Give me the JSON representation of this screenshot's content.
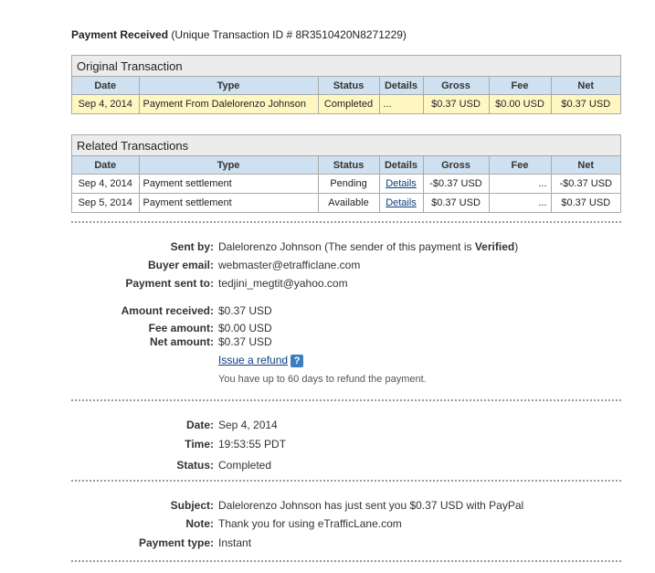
{
  "header": {
    "title": "Payment Received",
    "transaction_id": "(Unique Transaction ID # 8R3510420N8271229)"
  },
  "columns": [
    "Date",
    "Type",
    "Status",
    "Details",
    "Gross",
    "Fee",
    "Net"
  ],
  "original": {
    "title": "Original Transaction",
    "row": {
      "date": "Sep 4, 2014",
      "type": "Payment From Dalelorenzo Johnson",
      "status": "Completed",
      "details": "...",
      "gross": "$0.37 USD",
      "fee": "$0.00 USD",
      "net": "$0.37 USD"
    }
  },
  "related": {
    "title": "Related Transactions",
    "rows": [
      {
        "date": "Sep 4, 2014",
        "type": "Payment settlement",
        "status": "Pending",
        "details": "Details",
        "gross": "-$0.37 USD",
        "fee": "...",
        "net": "-$0.37 USD"
      },
      {
        "date": "Sep 5, 2014",
        "type": "Payment settlement",
        "status": "Available",
        "details": "Details",
        "gross": "$0.37 USD",
        "fee": "...",
        "net": "$0.37 USD"
      }
    ]
  },
  "sender": {
    "sent_by_label": "Sent by:",
    "sent_by_name": "Dalelorenzo Johnson",
    "sent_by_note_pre": "(The sender of this payment is ",
    "sent_by_verified": "Verified",
    "sent_by_note_post": ")",
    "buyer_email_label": "Buyer email:",
    "buyer_email": "webmaster@etrafficlane.com",
    "sent_to_label": "Payment sent to:",
    "sent_to": "tedjini_megtit@yahoo.com"
  },
  "amounts": {
    "received_label": "Amount received:",
    "received": "$0.37 USD",
    "fee_label": "Fee amount:",
    "fee": "$0.00 USD",
    "net_label": "Net amount:",
    "net": "$0.37 USD",
    "refund_link": "Issue a refund",
    "help_glyph": "?",
    "refund_note": "You have up to 60 days to refund the payment."
  },
  "timing": {
    "date_label": "Date:",
    "date": "Sep 4, 2014",
    "time_label": "Time:",
    "time": "19:53:55 PDT",
    "status_label": "Status:",
    "status": "Completed"
  },
  "message": {
    "subject_label": "Subject:",
    "subject": "Dalelorenzo Johnson has just sent you $0.37 USD with PayPal",
    "note_label": "Note:",
    "note": "Thank you for using eTrafficLane.com",
    "payment_type_label": "Payment type:",
    "payment_type": "Instant"
  },
  "colors": {
    "header_row": "#cfe0f0",
    "highlight_row": "#fff7c2",
    "link": "#0b3f7a",
    "help_icon": "#3d7ec2"
  }
}
